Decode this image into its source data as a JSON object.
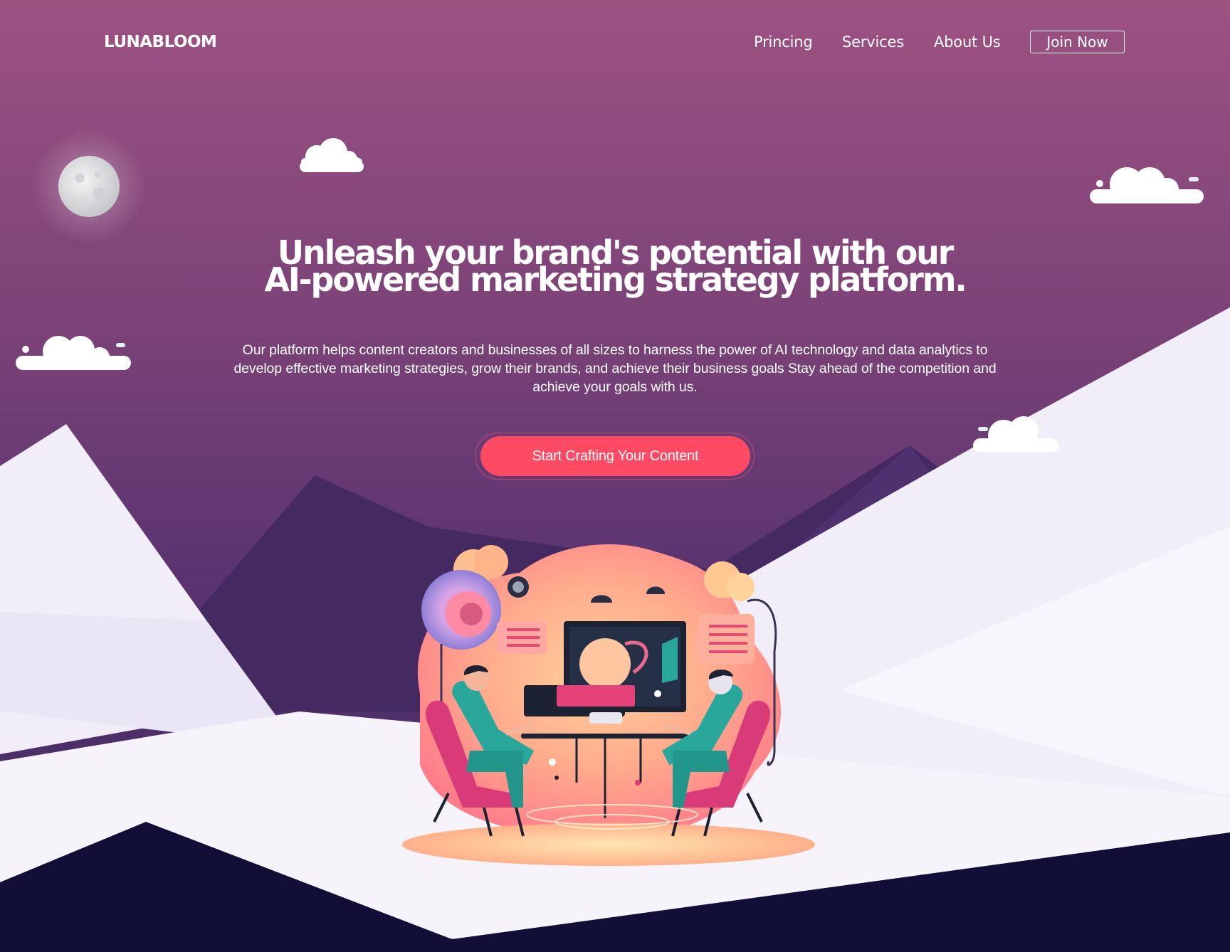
{
  "header": {
    "brand": "LUNABLOOM",
    "nav": [
      {
        "label": "Princing"
      },
      {
        "label": "Services"
      },
      {
        "label": "About Us"
      }
    ],
    "join_label": "Join Now"
  },
  "hero": {
    "headline_line1": "Unleash your brand's potential with our",
    "headline_line2": "AI-powered marketing strategy platform.",
    "description": "Our platform helps content creators and businesses of all sizes to harness the power of AI technology and data analytics to develop effective marketing strategies, grow their brands, and achieve their business goals Stay ahead of the competition and achieve your goals with us.",
    "cta_label": "Start Crafting Your Content"
  },
  "colors": {
    "sky_top": "#9d5282",
    "sky_bottom": "#4a2d68",
    "accent": "#ff4a63",
    "ground": "#110f38",
    "snow": "#f4f1fb"
  }
}
